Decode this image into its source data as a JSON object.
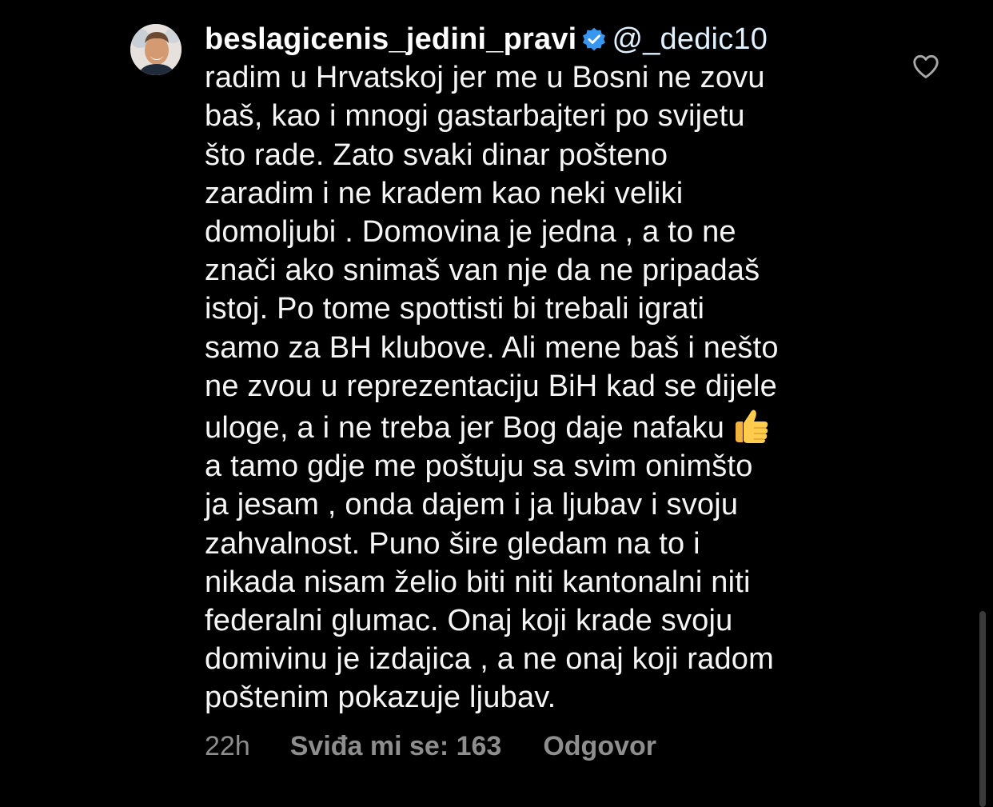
{
  "comment": {
    "username": "beslagicenis_jedini_pravi",
    "mention": "@_dedic10",
    "lines": [
      "radim u Hrvatskoj jer me u Bosni ne zovu",
      "baš, kao i mnogi gastarbajteri po svijetu",
      "što rade. Zato svaki dinar pošteno",
      "zaradim i ne kradem kao neki veliki",
      "domoljubi . Domovina je jedna , a to ne",
      "znači ako snimaš van nje da ne pripadaš",
      "istoj. Po tome spottisti bi trebali igrati",
      "samo za BH klubove. Ali mene baš i nešto",
      "ne zvou u reprezentaciju BiH kad se dijele",
      "uloge, a i ne treba jer Bog daje nafaku",
      "a tamo gdje me poštuju sa svim onimšto",
      "ja jesam , onda dajem i ja ljubav i svoju",
      "zahvalnost. Puno šire gledam na to i",
      "nikada nisam želio biti niti kantonalni niti",
      "federalni glumac. Onaj koji krade svoju",
      "domivinu je izdajica , a ne onaj koji radom",
      "poštenim pokazuje ljubav."
    ],
    "emoji": "thumbs-up-emoji"
  },
  "meta": {
    "time": "22h",
    "likes": "Sviđa mi se: 163",
    "reply": "Odgovor"
  },
  "icons": {
    "verified": "verified-badge-icon",
    "like": "heart-icon",
    "avatar": "avatar"
  },
  "colors": {
    "background": "#000000",
    "text": "#f5f5f5",
    "muted": "#8e8e8e",
    "verified": "#3797f0",
    "mention": "#e0f1ff"
  }
}
